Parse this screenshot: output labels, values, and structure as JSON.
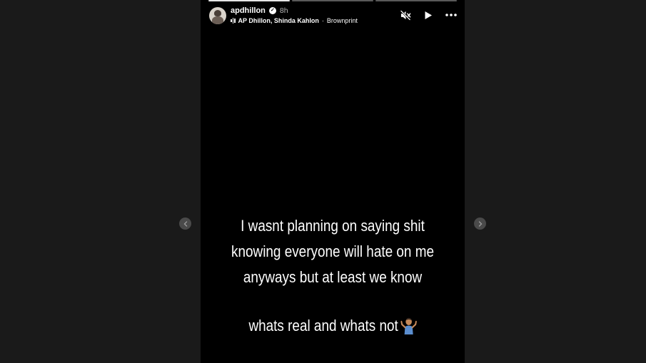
{
  "story": {
    "progress_segments": [
      {
        "done": true
      },
      {
        "done": false
      },
      {
        "done": false
      }
    ],
    "user": {
      "username": "apdhillon",
      "time_ago": "8h",
      "verified": true
    },
    "music": {
      "artist": "AP Dhillon, Shinda Kahlon",
      "separator": "·",
      "title": "Brownprint"
    },
    "controls": {
      "mute_icon": "muted-speaker-icon",
      "play_icon": "play-icon",
      "more_icon": "more-options-icon"
    },
    "text": "I wasnt planning on saying shit\nknowing everyone will hate on me\nanyways but at least we know\nwhats real and whats not",
    "text_emoji": "shrug-emoji"
  },
  "navigation": {
    "prev_icon": "chevron-left-icon",
    "next_icon": "chevron-right-icon"
  },
  "colors": {
    "page_background": "#1a1a1a",
    "story_background": "#000000",
    "nav_button": "#4a4a4a",
    "text": "#ffffff"
  }
}
